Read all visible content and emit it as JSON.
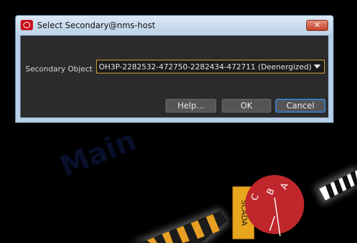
{
  "dialog": {
    "title": "Select Secondary@nms-host",
    "close_label": "✕",
    "secondary_object_label": "Secondary Object",
    "secondary_object_value": "OH3P-2282532-472750-2282434-472711 (Deenergized)",
    "help_label": "Help...",
    "ok_label": "OK",
    "cancel_label": "Cancel"
  },
  "map": {
    "scada_label": "SCADA",
    "phase_labels": [
      "A",
      "B",
      "C"
    ],
    "watermark_text": "Main"
  },
  "colors": {
    "map_background": "#000000",
    "scada_label_bg": "#e8a61e",
    "device_red": "#c0272d",
    "line_orange": "#e8a023",
    "accent_focus": "#4a8fd8"
  }
}
